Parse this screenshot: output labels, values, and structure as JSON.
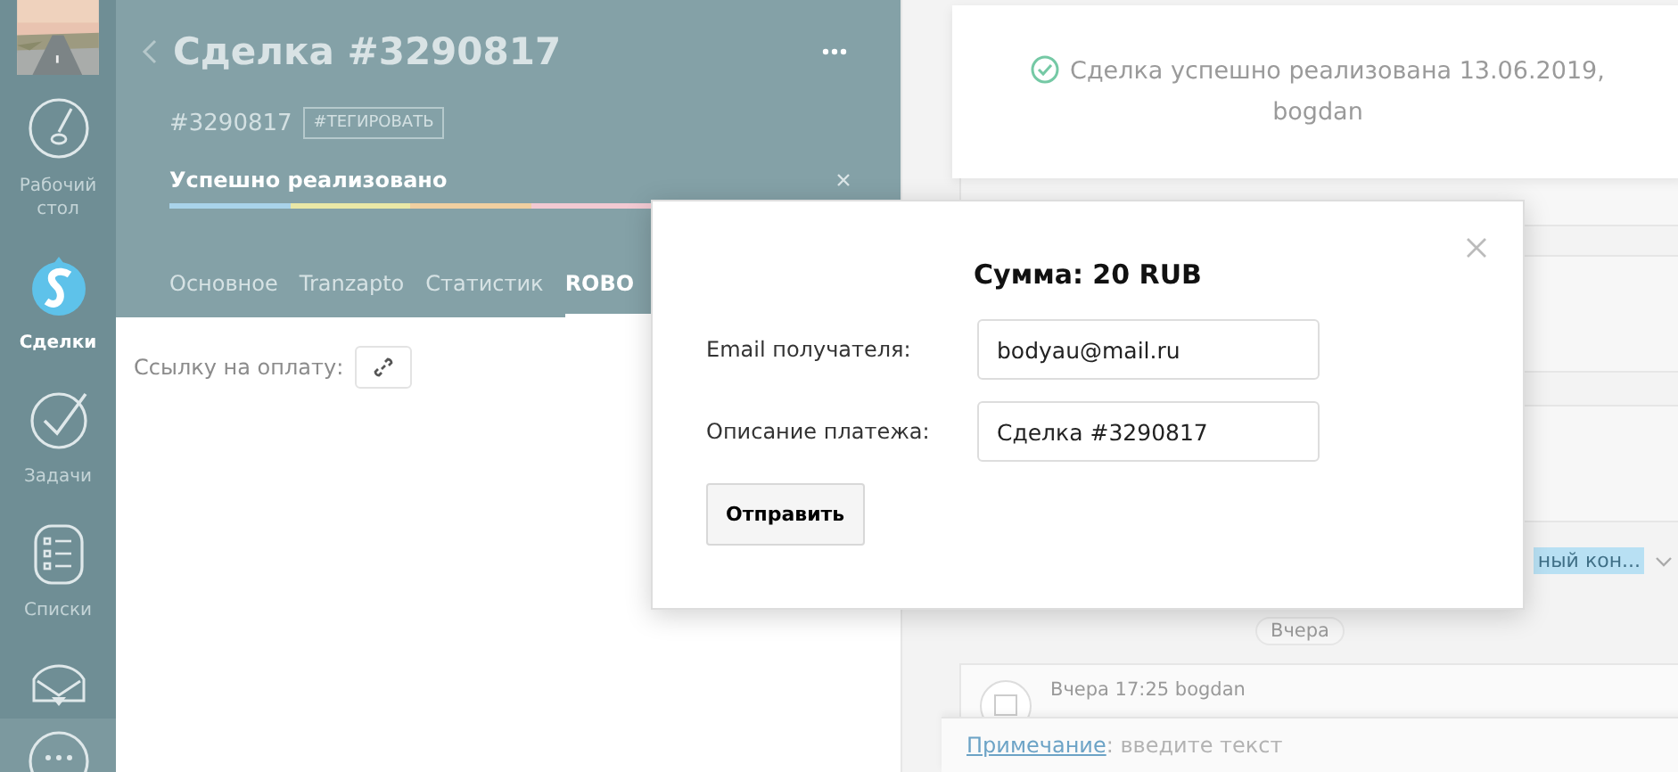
{
  "sidebar": {
    "items": [
      {
        "label": "Рабочий стол",
        "selected": false
      },
      {
        "label": "Сделки",
        "selected": true
      },
      {
        "label": "Задачи",
        "selected": false
      },
      {
        "label": "Списки",
        "selected": false
      }
    ]
  },
  "deal": {
    "title": "Сделка #3290817",
    "number": "#3290817",
    "tag_button": "#ТЕГИРОВАТЬ",
    "status": "Успешно реализовано",
    "stages": [
      {
        "color": "#a9d3ea"
      },
      {
        "color": "#e9e7a6"
      },
      {
        "color": "#f0cfa0"
      },
      {
        "color": "#f2c9d2"
      }
    ],
    "tabs": [
      {
        "label": "Основное",
        "selected": false
      },
      {
        "label": "Tranzapto",
        "selected": false
      },
      {
        "label": "Статистик",
        "selected": false
      },
      {
        "label": "ROBO",
        "selected": true
      }
    ],
    "payment_link_label": "Ссылку на оплату:"
  },
  "feed": {
    "notice": "Сделка успешно реализована 13.06.2019, bogdan",
    "tag": "ный кон...",
    "date_pill": "Вчера",
    "entry_meta": "Вчера 17:25 bogdan",
    "note_link": "Примечание",
    "note_placeholder": ": введите текст"
  },
  "modal": {
    "title": "Сумма: 20 RUB",
    "fields": [
      {
        "label": "Email получателя:",
        "value": "bodyau@mail.ru"
      },
      {
        "label": "Описание платежа:",
        "value": "Сделка #3290817"
      }
    ],
    "button": "Отправить"
  }
}
